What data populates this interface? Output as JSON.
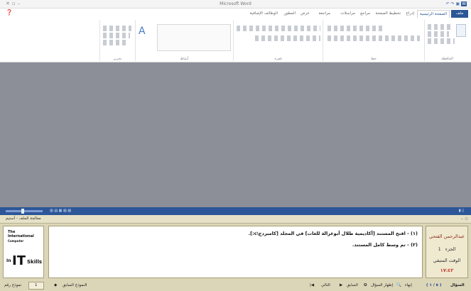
{
  "window": {
    "title": "Microsoft Word"
  },
  "tabs": [
    "ملف",
    "الصفحة الرئيسية",
    "إدراج",
    "تخطيط الصفحة",
    "مراجع",
    "مراسلات",
    "مراجعة",
    "عرض",
    "المطور",
    "الوظائف الإضافية"
  ],
  "ribbon": {
    "groups": [
      "الحافظة",
      "خط",
      "فقرة",
      "أنماط",
      "تحرير"
    ]
  },
  "panel": {
    "header_title": "معالجة الملف - أستيم",
    "logo": {
      "line1": "The",
      "line2": "International",
      "line3": "Computer",
      "line4": "Skills",
      "mark": "IT",
      "in": "In"
    },
    "instructions": [
      "(١) - افتح المستند [أكاديمية طلال أبوغزالة للغات] في المجلد [كامبردج\\c:].",
      "(٢) - تم وسط كامل المستند."
    ],
    "side": {
      "name": "عبدالرحمن الفتحي",
      "part_label": "الجزء",
      "part_value": "1",
      "time_label": "الوقت المتبقي",
      "time_value": "١٧:٤٢"
    },
    "bottom": {
      "question_label": "السؤال",
      "question_value": "( ٥ / ١ )",
      "end": "إنهاء",
      "result": "إظهار السؤال",
      "prev": "السابق",
      "next": "التالي",
      "previous_version": "النموذج السابق",
      "form_label": "نموذج رقم",
      "form_number": "1"
    }
  }
}
